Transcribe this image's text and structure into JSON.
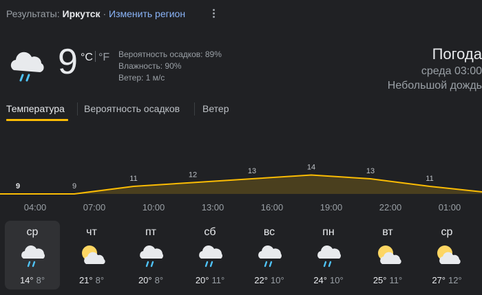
{
  "header": {
    "results_label": "Результаты:",
    "city": "Иркутск",
    "separator": "·",
    "change_region": "Изменить регион",
    "more_icon": "kebab-icon"
  },
  "current": {
    "icon": "rain-cloud-icon",
    "temperature": "9",
    "unit_c": "°C",
    "unit_f": "°F",
    "precipitation": "Вероятность осадков: 89%",
    "humidity": "Влажность: 90%",
    "wind": "Ветер: 1 м/с",
    "title": "Погода",
    "time": "среда 03:00",
    "condition": "Небольшой дождь"
  },
  "tabs": [
    {
      "label": "Температура",
      "active": true
    },
    {
      "label": "Вероятность осадков",
      "active": false
    },
    {
      "label": "Ветер",
      "active": false
    }
  ],
  "chart_data": {
    "type": "area",
    "x": [
      "04:00",
      "07:00",
      "10:00",
      "13:00",
      "16:00",
      "19:00",
      "22:00",
      "01:00"
    ],
    "values": [
      9,
      9,
      11,
      12,
      13,
      14,
      13,
      11
    ],
    "curve_colors": {
      "line": "#fbbc04",
      "fill": "#4a3f1e"
    }
  },
  "days": [
    {
      "name": "ср",
      "icon": "rain-cloud-icon",
      "high": "14°",
      "low": "8°",
      "selected": true
    },
    {
      "name": "чт",
      "icon": "partly-sunny-icon",
      "high": "21°",
      "low": "8°",
      "selected": false
    },
    {
      "name": "пт",
      "icon": "rain-cloud-icon",
      "high": "20°",
      "low": "8°",
      "selected": false
    },
    {
      "name": "сб",
      "icon": "rain-cloud-icon",
      "high": "20°",
      "low": "11°",
      "selected": false
    },
    {
      "name": "вс",
      "icon": "rain-cloud-icon",
      "high": "22°",
      "low": "10°",
      "selected": false
    },
    {
      "name": "пн",
      "icon": "rain-cloud-icon",
      "high": "24°",
      "low": "10°",
      "selected": false
    },
    {
      "name": "вт",
      "icon": "partly-sunny-icon",
      "high": "25°",
      "low": "11°",
      "selected": false
    },
    {
      "name": "ср",
      "icon": "partly-sunny-icon",
      "high": "27°",
      "low": "12°",
      "selected": false
    }
  ]
}
